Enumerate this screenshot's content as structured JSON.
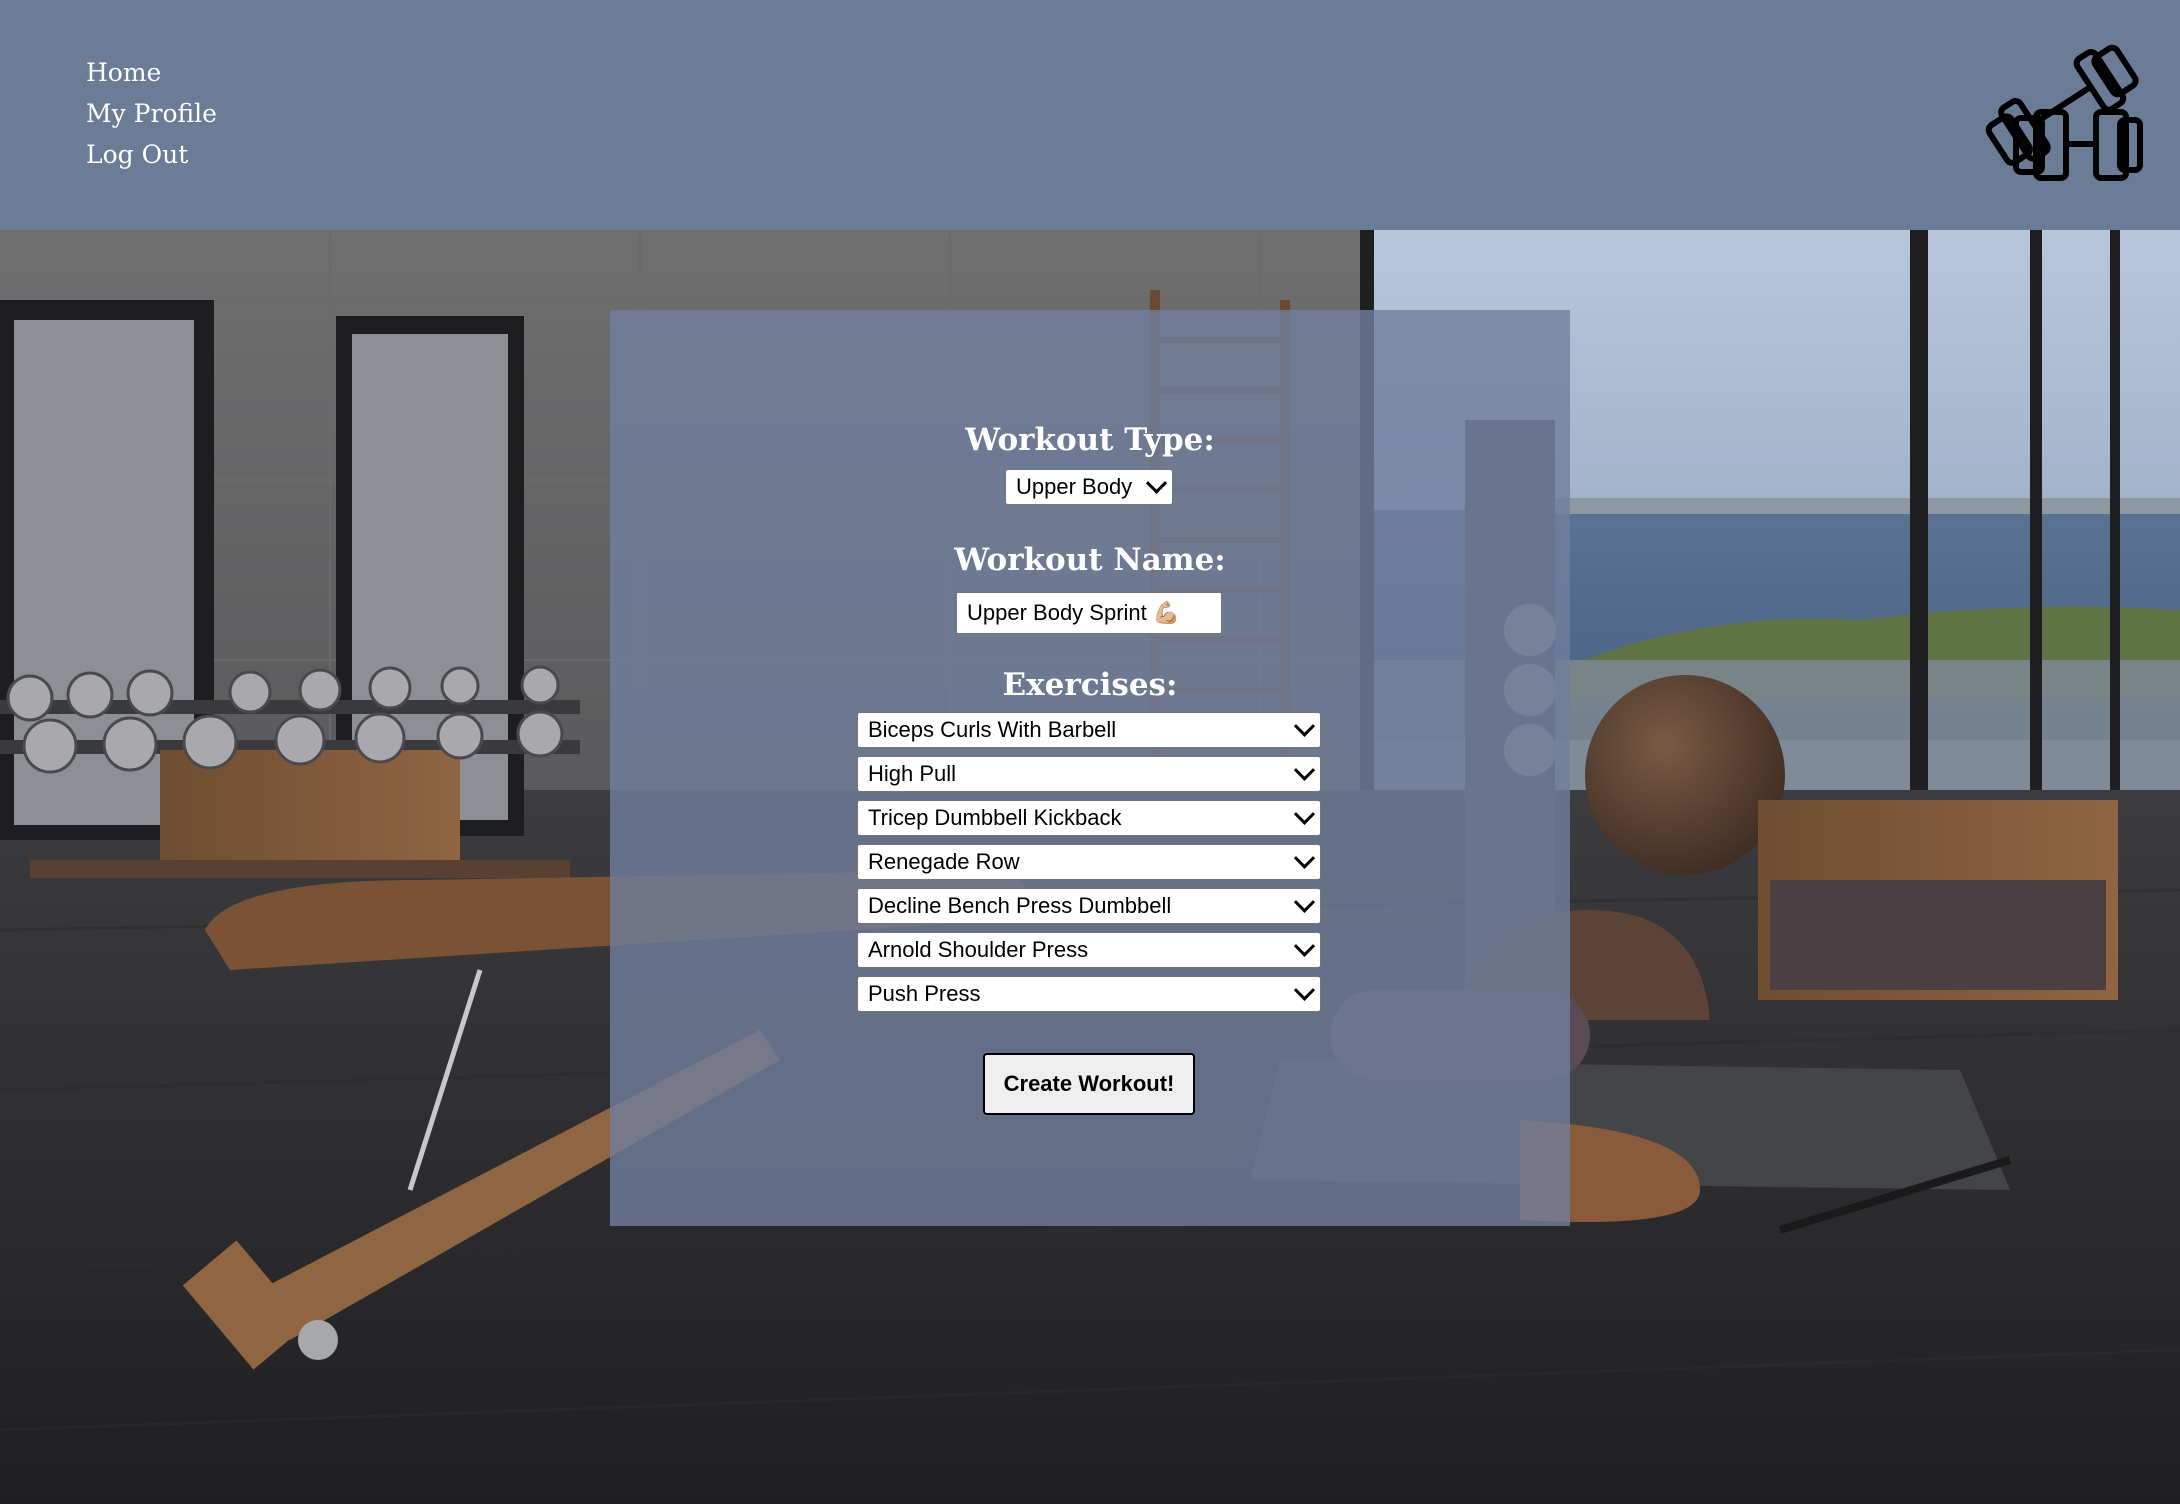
{
  "nav": {
    "items": [
      {
        "label": "Home"
      },
      {
        "label": "My Profile"
      },
      {
        "label": "Log Out"
      }
    ]
  },
  "brand": {
    "logo_icon": "dumbbells-icon"
  },
  "form": {
    "workout_type": {
      "label": "Workout Type:",
      "selected": "Upper Body"
    },
    "workout_name": {
      "label": "Workout Name:",
      "value": "Upper Body Sprint 💪🏼"
    },
    "exercises": {
      "label": "Exercises:",
      "items": [
        "Biceps Curls With Barbell",
        "High Pull",
        "Tricep Dumbbell Kickback",
        "Renegade Row",
        "Decline Bench Press Dumbbell",
        "Arnold Shoulder Press",
        "Push Press"
      ]
    },
    "submit_label": "Create Workout!"
  },
  "colors": {
    "header_bg": "#6b7c97",
    "panel_bg": "rgba(112,126,158,0.80)",
    "text_light": "#ffffff"
  }
}
